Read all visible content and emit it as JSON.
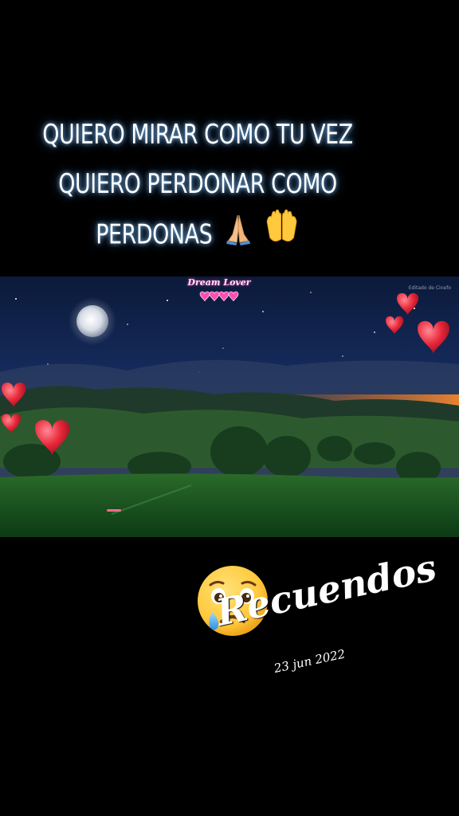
{
  "caption": {
    "line1": "QUIERO MIRAR COMO TU VEZ",
    "line2": "QUIERO PERDONAR COMO",
    "line3": "PERDONAS",
    "emojis": [
      "folded-hands-icon",
      "palms-up-together-icon"
    ]
  },
  "video": {
    "watermark_title": "Dream Lover",
    "watermark_corner": "Editado de Cinefo",
    "scene": [
      "moon",
      "stars",
      "hills",
      "trees",
      "meadow",
      "hearts"
    ]
  },
  "sticker": {
    "emoji": "crying-face-icon",
    "title": "Recuendos",
    "date": "23 jun 2022"
  },
  "colors": {
    "background": "#000000",
    "caption_glow": "#5aa8ff",
    "heart": "#e8283a"
  }
}
